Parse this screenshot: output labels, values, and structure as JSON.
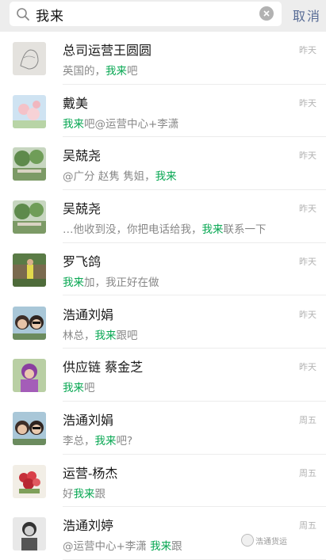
{
  "search": {
    "query": "我来",
    "cancel_label": "取消"
  },
  "results": [
    {
      "name": "总司运营王圆圆",
      "time": "昨天",
      "snippet": [
        {
          "t": "英国的，"
        },
        {
          "t": "我来",
          "hl": true
        },
        {
          "t": "吧"
        }
      ],
      "avatar": "sketch-avatar"
    },
    {
      "name": "戴美",
      "time": "昨天",
      "snippet": [
        {
          "t": "我来",
          "hl": true
        },
        {
          "t": "吧@运营中心+李潇"
        }
      ],
      "avatar": "flower-avatar"
    },
    {
      "name": "吴兢尧",
      "time": "昨天",
      "snippet": [
        {
          "t": "@广分 赵隽 隽姐，"
        },
        {
          "t": "我来",
          "hl": true
        }
      ],
      "avatar": "garden-avatar"
    },
    {
      "name": "吴兢尧",
      "time": "昨天",
      "snippet": [
        {
          "t": "…他收到没，你把电话给我，"
        },
        {
          "t": "我来",
          "hl": true
        },
        {
          "t": "联系一下"
        }
      ],
      "avatar": "garden-avatar"
    },
    {
      "name": "罗飞鸽",
      "time": "昨天",
      "snippet": [
        {
          "t": "我来",
          "hl": true
        },
        {
          "t": "加，我正好在做"
        }
      ],
      "avatar": "person-outdoor-avatar"
    },
    {
      "name": "浩通刘娟",
      "time": "昨天",
      "snippet": [
        {
          "t": "林总，"
        },
        {
          "t": "我来",
          "hl": true
        },
        {
          "t": "跟吧"
        }
      ],
      "avatar": "woman-sunglasses-avatar"
    },
    {
      "name": "供应链 蔡金芝",
      "time": "昨天",
      "snippet": [
        {
          "t": "我来",
          "hl": true
        },
        {
          "t": "吧"
        }
      ],
      "avatar": "purple-hair-avatar"
    },
    {
      "name": "浩通刘娟",
      "time": "周五",
      "snippet": [
        {
          "t": "李总，"
        },
        {
          "t": "我来",
          "hl": true
        },
        {
          "t": "吧?"
        }
      ],
      "avatar": "woman-sunglasses-avatar"
    },
    {
      "name": "运营-杨杰",
      "time": "周五",
      "snippet": [
        {
          "t": "好"
        },
        {
          "t": "我来",
          "hl": true
        },
        {
          "t": "跟"
        }
      ],
      "avatar": "roses-avatar"
    },
    {
      "name": "浩通刘婷",
      "time": "周五",
      "snippet": [
        {
          "t": "@运营中心+李潇 "
        },
        {
          "t": "我来",
          "hl": true
        },
        {
          "t": "跟"
        }
      ],
      "avatar": "bw-woman-avatar"
    }
  ],
  "watermark": "浩通货运",
  "colors": {
    "highlight": "#07a752",
    "cancel": "#576b95",
    "snippet": "#888888",
    "time": "#b2b2b2"
  }
}
